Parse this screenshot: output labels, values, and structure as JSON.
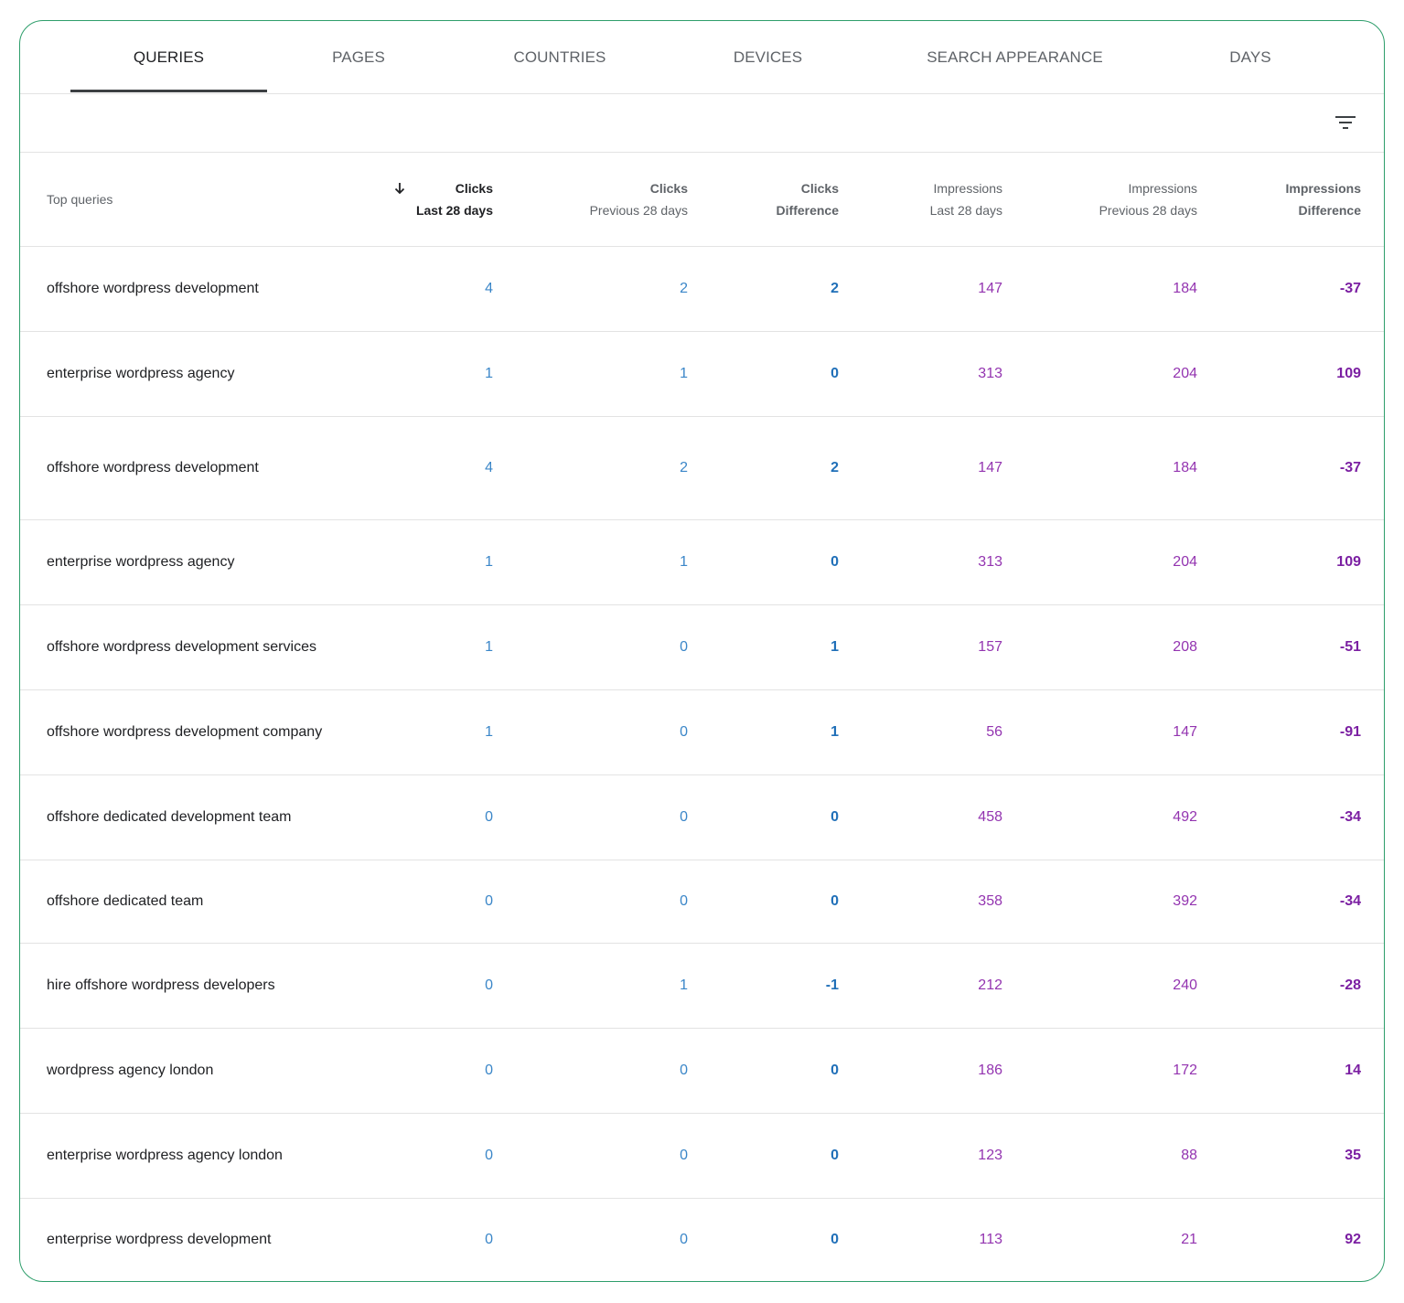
{
  "tabs": [
    "QUERIES",
    "PAGES",
    "COUNTRIES",
    "DEVICES",
    "SEARCH APPEARANCE",
    "DAYS"
  ],
  "active_tab": "QUERIES",
  "toolbar": {
    "filter_icon": "filter-list-icon"
  },
  "colors": {
    "border": "#2e9e6b",
    "clicks": "#3a86c8",
    "impressions": "#9334b0"
  },
  "table": {
    "headers": [
      {
        "l1": "Top queries",
        "l2": ""
      },
      {
        "l1": "Clicks",
        "l2": "Last 28 days",
        "sort": "descending"
      },
      {
        "l1": "Clicks",
        "l2": "Previous 28 days"
      },
      {
        "l1": "Clicks",
        "l2": "Difference"
      },
      {
        "l1": "Impressions",
        "l2": "Last 28 days"
      },
      {
        "l1": "Impressions",
        "l2": "Previous 28 days"
      },
      {
        "l1": "Impressions",
        "l2": "Difference"
      }
    ],
    "rows": [
      {
        "query": "offshore wordpress development",
        "clicks_last": "4",
        "clicks_prev": "2",
        "clicks_diff": "2",
        "impr_last": "147",
        "impr_prev": "184",
        "impr_diff": "-37"
      },
      {
        "query": "enterprise wordpress agency",
        "clicks_last": "1",
        "clicks_prev": "1",
        "clicks_diff": "0",
        "impr_last": "313",
        "impr_prev": "204",
        "impr_diff": "109"
      },
      {
        "query": "offshore wordpress development",
        "clicks_last": "4",
        "clicks_prev": "2",
        "clicks_diff": "2",
        "impr_last": "147",
        "impr_prev": "184",
        "impr_diff": "-37"
      },
      {
        "query": "enterprise wordpress agency",
        "clicks_last": "1",
        "clicks_prev": "1",
        "clicks_diff": "0",
        "impr_last": "313",
        "impr_prev": "204",
        "impr_diff": "109"
      },
      {
        "query": "offshore wordpress development services",
        "clicks_last": "1",
        "clicks_prev": "0",
        "clicks_diff": "1",
        "impr_last": "157",
        "impr_prev": "208",
        "impr_diff": "-51"
      },
      {
        "query": "offshore wordpress development company",
        "clicks_last": "1",
        "clicks_prev": "0",
        "clicks_diff": "1",
        "impr_last": "56",
        "impr_prev": "147",
        "impr_diff": "-91"
      },
      {
        "query": "offshore dedicated development team",
        "clicks_last": "0",
        "clicks_prev": "0",
        "clicks_diff": "0",
        "impr_last": "458",
        "impr_prev": "492",
        "impr_diff": "-34"
      },
      {
        "query": "offshore dedicated team",
        "clicks_last": "0",
        "clicks_prev": "0",
        "clicks_diff": "0",
        "impr_last": "358",
        "impr_prev": "392",
        "impr_diff": "-34"
      },
      {
        "query": "hire offshore wordpress developers",
        "clicks_last": "0",
        "clicks_prev": "1",
        "clicks_diff": "-1",
        "impr_last": "212",
        "impr_prev": "240",
        "impr_diff": "-28"
      },
      {
        "query": "wordpress agency london",
        "clicks_last": "0",
        "clicks_prev": "0",
        "clicks_diff": "0",
        "impr_last": "186",
        "impr_prev": "172",
        "impr_diff": "14"
      },
      {
        "query": "enterprise wordpress agency london",
        "clicks_last": "0",
        "clicks_prev": "0",
        "clicks_diff": "0",
        "impr_last": "123",
        "impr_prev": "88",
        "impr_diff": "35"
      },
      {
        "query": "enterprise wordpress development",
        "clicks_last": "0",
        "clicks_prev": "0",
        "clicks_diff": "0",
        "impr_last": "113",
        "impr_prev": "21",
        "impr_diff": "92"
      }
    ]
  }
}
